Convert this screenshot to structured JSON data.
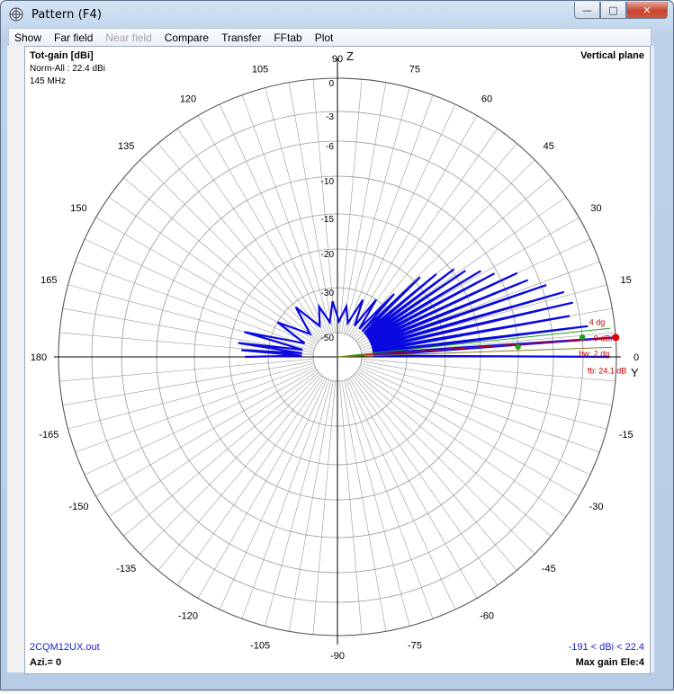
{
  "window": {
    "title": "Pattern   (F4)",
    "buttons": {
      "minimize": "—",
      "maximize": "□",
      "close": "✕"
    }
  },
  "menu": [
    "Show",
    "Far field",
    "Near field",
    "Compare",
    "Transfer",
    "FFtab",
    "Plot"
  ],
  "menu_disabled": [
    "Near field"
  ],
  "info": {
    "gain_label": "Tot-gain [dBi]",
    "norm": "Norm-All : 22.4 dBi",
    "freq": "145 MHz",
    "plane": "Vertical plane",
    "filename": "2CQM12UX.out",
    "azimuth": "Azi.= 0",
    "range": "-191 < dBi < 22.4",
    "max_gain": "Max gain Ele:4"
  },
  "axis_letters": {
    "z": "Z",
    "y": "Y"
  },
  "angle_labels": [
    "0",
    "15",
    "30",
    "45",
    "60",
    "75",
    "90",
    "105",
    "120",
    "135",
    "150",
    "165",
    "180",
    "-165",
    "-150",
    "-135",
    "-120",
    "-105",
    "-90",
    "-75",
    "-60",
    "-45",
    "-30",
    "-15"
  ],
  "ring_labels": [
    "0",
    "-3",
    "-6",
    "-10",
    "-15",
    "-20",
    "-30",
    "-50"
  ],
  "markers": {
    "max_gain_deg": "4 dg",
    "zero_db": "0 dBi",
    "beamwidth": "bw: 2 dg",
    "front_back": "fb: 24.1 dB"
  },
  "colors": {
    "pattern": "#0a0ae0",
    "grid": "#9a9a9a",
    "marker_red": "#e00000",
    "marker_green": "#1ea01e"
  },
  "chart_data": {
    "type": "polar",
    "unit": "dBi (normalized)",
    "rings_db": [
      0,
      -3,
      -6,
      -10,
      -15,
      -20,
      -30,
      -50
    ],
    "angles_deg": [
      0,
      4,
      7,
      10,
      13,
      16,
      19,
      22,
      25,
      28,
      31,
      34,
      37,
      40,
      44,
      48,
      56,
      66,
      80,
      95,
      110,
      130,
      150,
      165,
      172,
      176,
      180
    ],
    "gain_db": [
      -0.6,
      0,
      -2.4,
      -4,
      -3.4,
      -4,
      -5.5,
      -7.2,
      -8,
      -10.4,
      -11.8,
      -13.5,
      -14.6,
      -17,
      -19,
      -26,
      -30,
      -33,
      -38,
      -36,
      -37,
      -32,
      -30,
      -23,
      -22,
      -23,
      -24
    ],
    "front_back_db": 24.1,
    "beamwidth_deg": 2,
    "max_gain_elevation_deg": 4
  }
}
